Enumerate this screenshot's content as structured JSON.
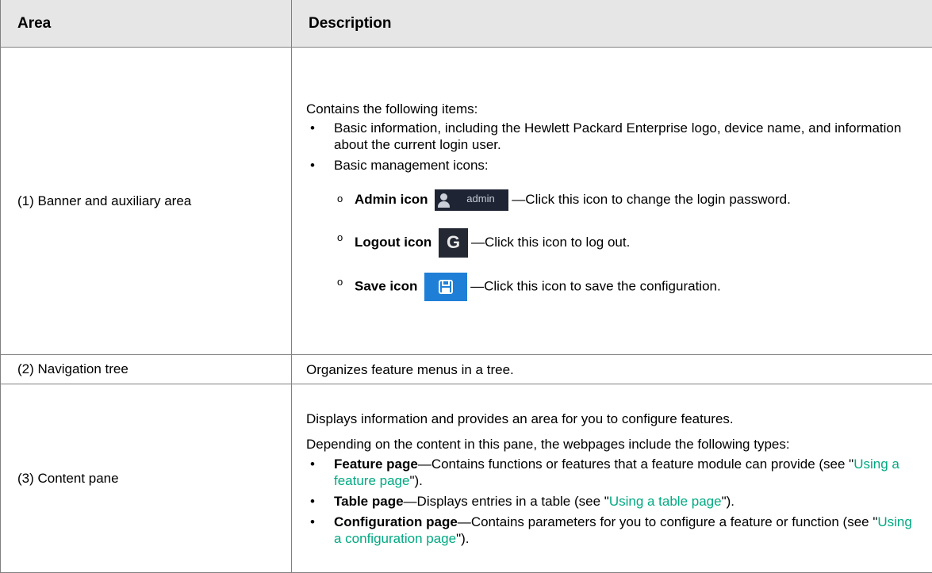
{
  "header": {
    "area": "Area",
    "description": "Description"
  },
  "rows": [
    {
      "area": "(1) Banner and auxiliary area",
      "intro": "Contains the following items:",
      "bullets": [
        "Basic information, including the Hewlett Packard Enterprise logo, device name, and information about the current login user.",
        "Basic management icons:"
      ],
      "icons": [
        {
          "label": "Admin icon",
          "icon_text": "admin",
          "text": "—Click this icon to change the login password."
        },
        {
          "label": "Logout icon",
          "text": "—Click this icon to log out."
        },
        {
          "label": "Save icon",
          "text": "—Click this icon to save the configuration."
        }
      ]
    },
    {
      "area": "(2) Navigation tree",
      "desc": "Organizes feature menus in a tree."
    },
    {
      "area": "(3) Content pane",
      "p1": "Displays information and provides an area for you to configure features.",
      "p2": "Depending on the content in this pane, the webpages include the following types:",
      "items": [
        {
          "bold": "Feature page",
          "text": "—Contains functions or features that a feature module can provide (see \"",
          "link": "Using a feature page",
          "after": "\")."
        },
        {
          "bold": "Table page",
          "text": "—Displays entries in a table (see \"",
          "link": "Using a table page",
          "after": "\")."
        },
        {
          "bold": "Configuration page",
          "text": "—Contains parameters for you to configure a feature or function (see \"",
          "link": "Using a configuration page",
          "after": "\")."
        }
      ]
    }
  ]
}
